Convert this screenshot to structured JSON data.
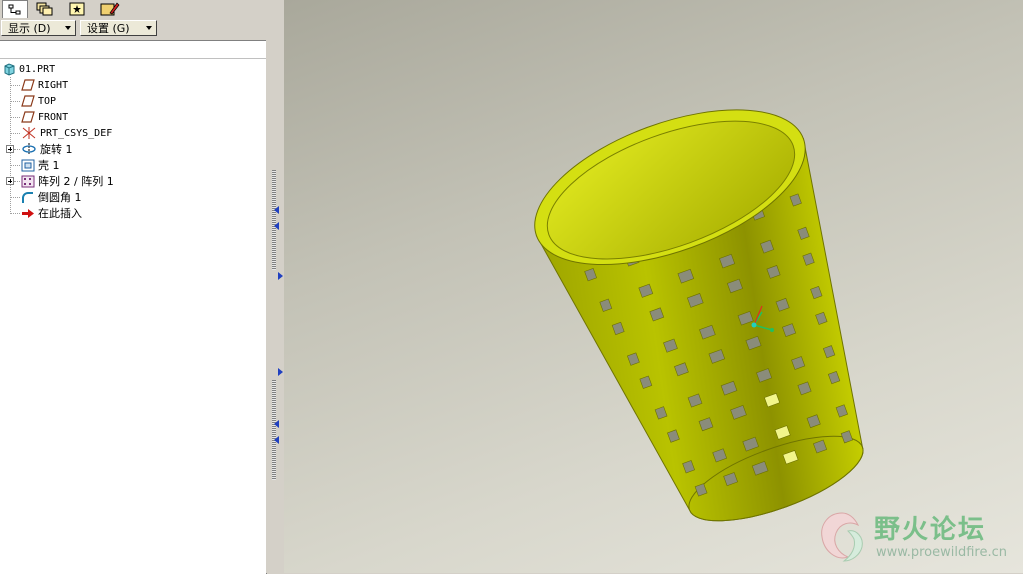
{
  "menus": {
    "display_label": "显示 (D)",
    "settings_label": "设置 (G)"
  },
  "tabs": [
    {
      "icon": "model-tree-icon"
    },
    {
      "icon": "layers-icon"
    },
    {
      "icon": "favorites-icon"
    },
    {
      "icon": "folder-browser-icon"
    }
  ],
  "tree": {
    "root": "01.PRT",
    "items": [
      {
        "label": "RIGHT",
        "icon": "datum-plane-icon"
      },
      {
        "label": "TOP",
        "icon": "datum-plane-icon"
      },
      {
        "label": "FRONT",
        "icon": "datum-plane-icon"
      },
      {
        "label": "PRT_CSYS_DEF",
        "icon": "csys-icon"
      },
      {
        "label": "旋转 1",
        "icon": "revolve-icon",
        "expandable": true
      },
      {
        "label": "壳 1",
        "icon": "shell-icon"
      },
      {
        "label": "阵列 2 / 阵列 1",
        "icon": "pattern-icon",
        "expandable": true
      },
      {
        "label": "倒圆角 1",
        "icon": "round-icon"
      },
      {
        "label": "在此插入",
        "icon": "insert-here-arrow-icon"
      }
    ]
  },
  "model": {
    "name": "perforated-cylindrical-basket",
    "color": "#b8c400",
    "rim_color": "#d7e21a",
    "hole_color": "#8a8c7a"
  },
  "watermark": {
    "title": "野火论坛",
    "url": "www.proewildfire.cn"
  }
}
